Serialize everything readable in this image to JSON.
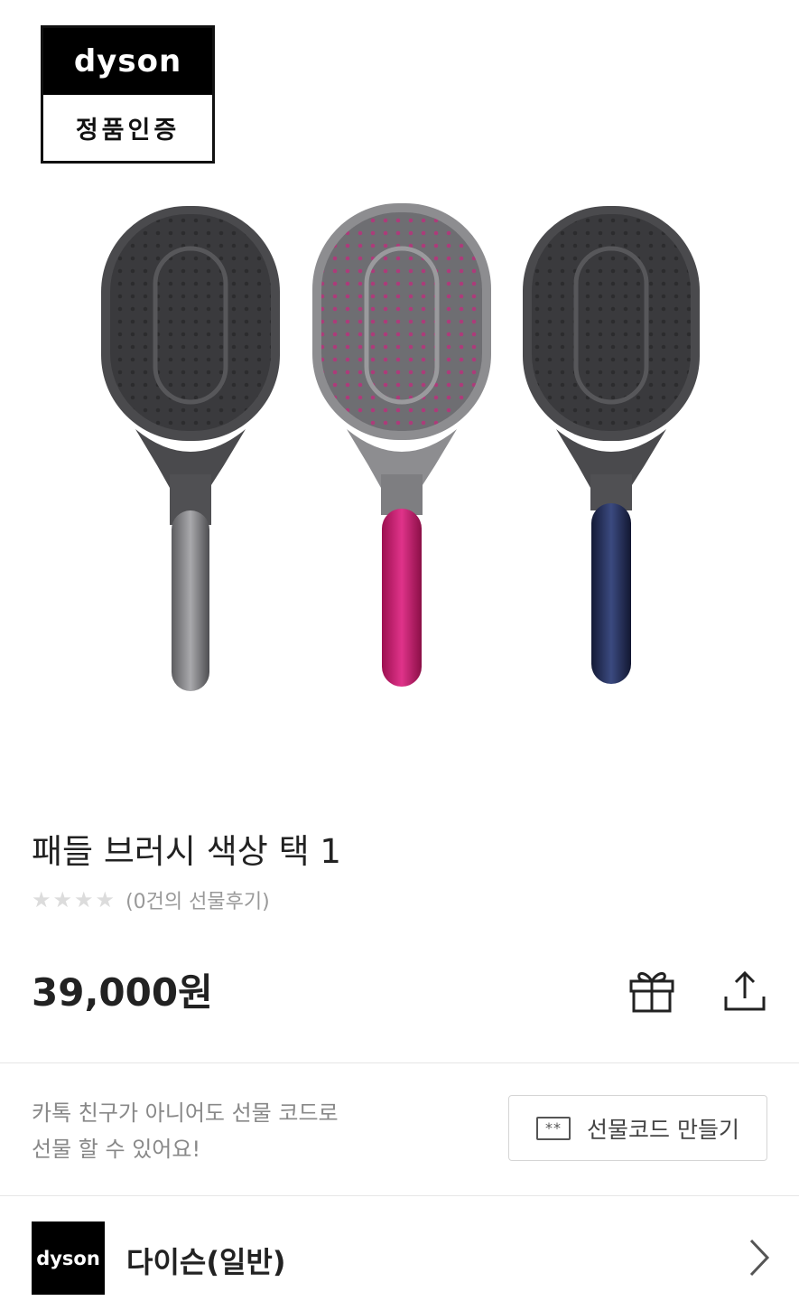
{
  "badge": {
    "brand": "dyson",
    "label": "정품인증"
  },
  "product": {
    "title": "패들 브러시 색상 택 1",
    "review_text": "(0건의 선물후기)",
    "rating_stars": 0,
    "price": "39,000원"
  },
  "brush_colors": [
    "#8a8a8e",
    "#c2185b",
    "#1f2a52"
  ],
  "promo": {
    "line1": "카톡 친구가 아니어도 선물 코드로",
    "line2": "선물 할 수 있어요!",
    "button_label": "선물코드 만들기",
    "button_icon_text": "**"
  },
  "brand": {
    "logo_text": "dyson",
    "name": "다이슨(일반)"
  },
  "icons": [
    "gift-icon",
    "share-icon",
    "gift-code-icon",
    "chevron-right-icon",
    "star-icon"
  ]
}
